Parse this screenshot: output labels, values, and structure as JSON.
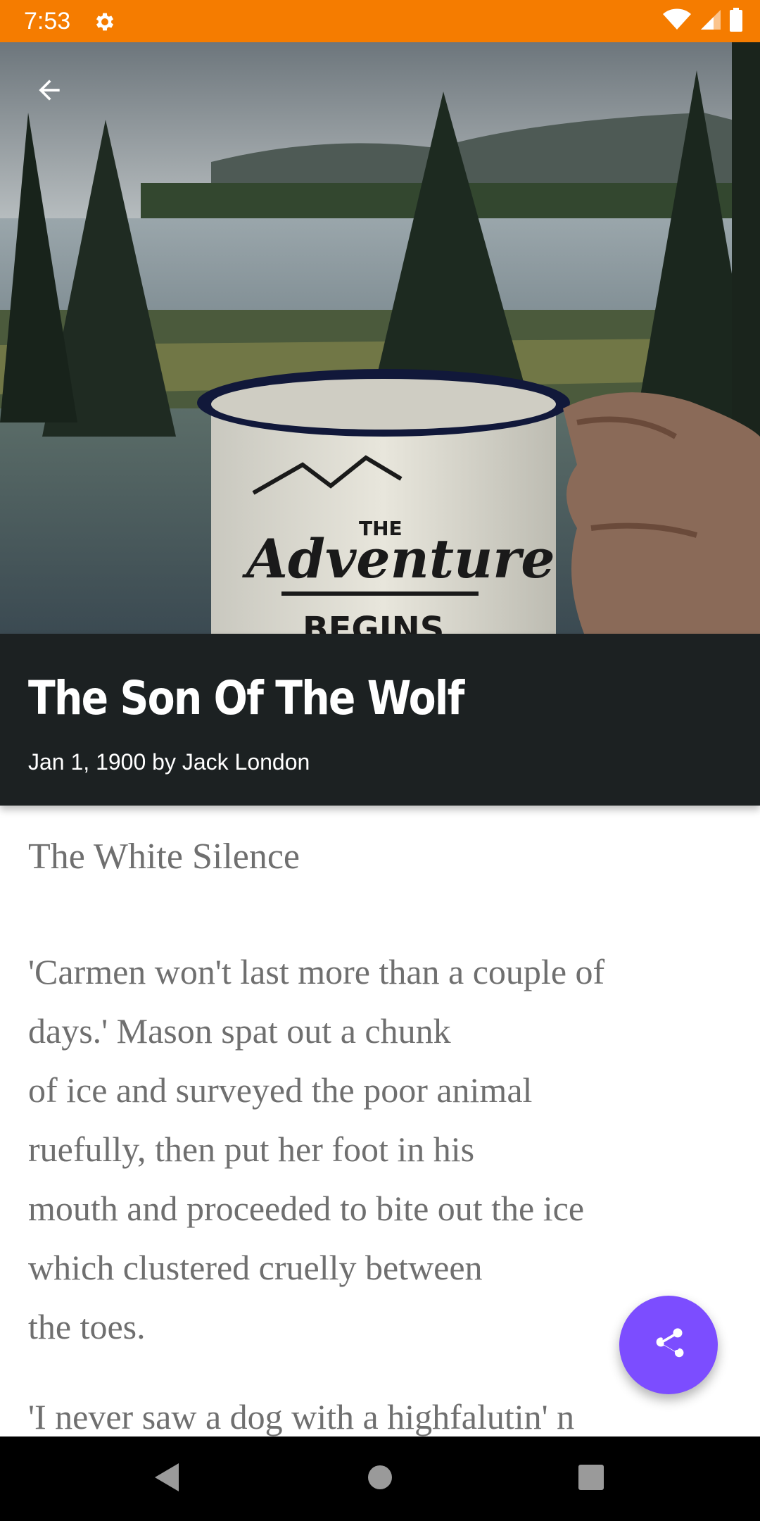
{
  "status_bar": {
    "time": "7:53",
    "settings_icon": "gear-icon",
    "wifi_icon": "wifi-icon",
    "signal_icon": "cell-signal-icon",
    "battery_icon": "battery-icon",
    "color": "#f57c00"
  },
  "hero": {
    "back_icon": "arrow-back-icon",
    "image_description_icon": "mug-photo",
    "mug_text_small": "THE",
    "mug_text_script": "Adventure",
    "mug_text_bottom": "BEGINS"
  },
  "article": {
    "title": "The Son Of The Wolf",
    "byline": "Jan 1, 1900 by Jack London",
    "chapter": "The White Silence",
    "paragraph": "'Carmen won't last more than a couple of\ndays.' Mason spat out a chunk\nof ice and surveyed the poor animal\nruefully, then put her foot in his\nmouth and proceeded to bite out the ice\nwhich clustered cruelly between\nthe toes.",
    "next_paragraph_partial": "'I never saw a dog with a highfalutin' n"
  },
  "fab": {
    "icon": "share-icon",
    "color": "#7c4dff"
  },
  "nav_bar": {
    "back_icon": "nav-back-icon",
    "home_icon": "nav-home-icon",
    "recents_icon": "nav-recents-icon"
  }
}
